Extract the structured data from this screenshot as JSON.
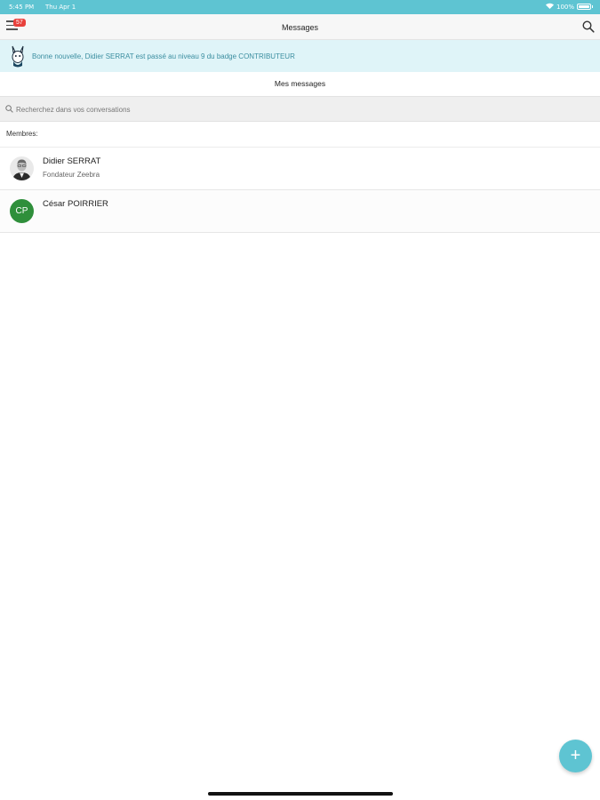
{
  "status_bar": {
    "time": "5:45 PM",
    "date": "Thu Apr 1",
    "battery": "100%",
    "background": "#5ec4d2"
  },
  "navbar": {
    "title": "Messages",
    "badge_count": "57",
    "menu_icon": "hamburger-menu-icon",
    "search_icon": "search-icon"
  },
  "banner": {
    "text": "Bonne nouvelle, Didier SERRAT est passé au niveau 9 du badge CONTRIBUTEUR",
    "icon": "zebra-mascot-icon",
    "background": "#dff4f8"
  },
  "section": {
    "title": "Mes messages"
  },
  "search": {
    "placeholder": "Recherchez dans vos conversations",
    "value": ""
  },
  "members": {
    "label": "Membres:",
    "items": [
      {
        "name": "Didier SERRAT",
        "subtitle": "Fondateur Zeebra",
        "avatar": "photo"
      },
      {
        "name": "César POIRRIER",
        "subtitle": "",
        "avatar": "CP",
        "avatar_color": "#2f8f3b"
      }
    ]
  },
  "fab": {
    "label": "+",
    "color": "#5ec4d2"
  }
}
